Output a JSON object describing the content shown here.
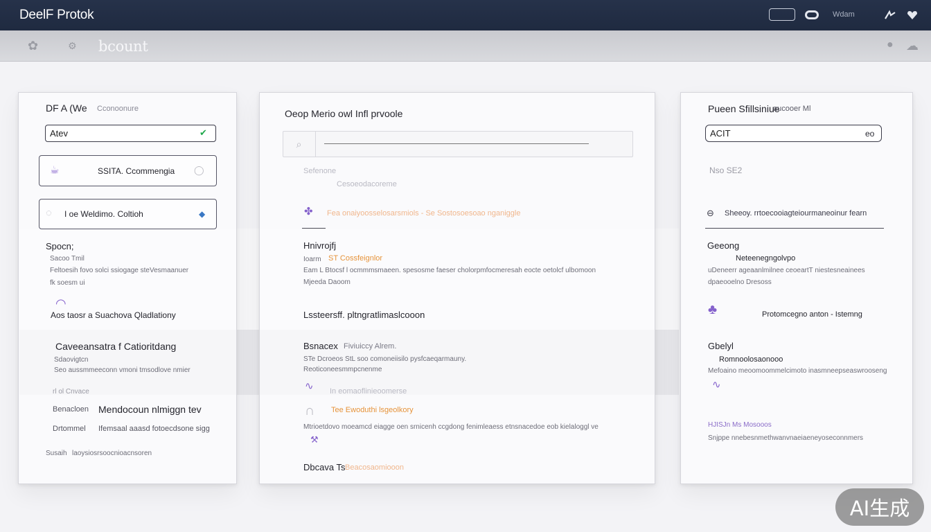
{
  "topbar": {
    "title": "DeelF Protok",
    "status_text": "Wdam",
    "icons": [
      "pill-icon",
      "toggle-icon",
      "share-icon",
      "heart-icon"
    ]
  },
  "subbar": {
    "title": "bcount",
    "icons": [
      "puzzle-icon",
      "gear-icon",
      "user-icon",
      "cloud-icon"
    ]
  },
  "left": {
    "header": "DF A (We",
    "header_sub": "Cconoonure",
    "input_value": "Atev",
    "card1_label": "SSITA. Ccommengia",
    "card2_label": "I oe Weldimo. Coltioh",
    "section1_title": "Spocn;",
    "section1_sub": "Sacoo Tmil",
    "section1_line1": "Feltoesih fovo solci ssiogage steVesmaanuer",
    "section1_line2": "fk soesm ui",
    "section2_title": "Aos taosr a Suachova Qladlationy",
    "section3_title": "Caveeansatra f Catioritdang",
    "section3_line1": "Sdaovigtcn",
    "section3_line2": "Seo aussmmeeconn vmoni tmsodlove nmier",
    "section3_line3": "rl ol Cnvace",
    "row1_key": "Benacloen",
    "row1_value": "Mendocoun nlmiggn tev",
    "row2_key": "Drtommel",
    "row2_value": "Ifemsaal aaasd fotoecdsone sigg",
    "row3_key": "Susaih",
    "row3_value": "laoysiosrsoocnioacnsoren"
  },
  "middle": {
    "header": "Oeop Merio owl Infl prvoole",
    "faint_line": "Sefenone",
    "faint_line2": "Cesoeodacoreme",
    "orange_row": "Fea onaiyoosselosarsmiols - Se Sostosoesoao nganiggle",
    "section1_title": "Hnivrojfj",
    "section1_sub_prefix": "Ioarm",
    "section1_sub": "ST Cossfeignlor",
    "section1_line1": "Eam L Btocsf l ocmmmsmaeen. spesosme faeser cholorpmfocmeresah eocte oetolcf ulbomoon",
    "section1_line2": "Mjeeda Daoom",
    "section2_title": "Lssteersff. pltngratlimaslcooon",
    "section3_title": "Bsnacex",
    "section3_sub": "Fiviuiccy Alrem.",
    "section3_line1": "STe Dcroeos StL soo comoneiisilo pysfcaeqarmauny.",
    "section3_line2": "Reoticoneesmmpcnenme",
    "section4_faint": "In eomaoflinieoomerse",
    "section4_orange": "Tee Ewoduthi lsgeolkory",
    "section4_line": "Mtrioetdovo moeamcd eiagge oen srnicenh ccgdong fenimleaess etnsnacedoe eob kielaloggl ve",
    "section5_title": "Dbcava Ts",
    "section5_sub": "Beacosaomiooon"
  },
  "right": {
    "header": "Pueen Sfillsiniue",
    "header_sub": "aucooer  Ml",
    "input_value": "ACIT",
    "input_suffix": "eo",
    "faint_value": "Nso  SE2",
    "link_row": "Sheeoy. rrtoecooiagteiourmaneoinur fearn",
    "section1_title": "Geeong",
    "section1_sub": "Neteenegngolvpo",
    "section1_line1": "uDeneerr ageaanlmilnee ceoeartT niestesneainees",
    "section1_line2": "dpaeooelno Dresoss",
    "tag_label": "Protomcegno anton - Istemng",
    "section2_title": "Gbelyl",
    "section2_sub": "Romnoolosaonooo",
    "section2_line": "Mefoaino meoomoommelcimoto inasmneepseaswrooseng",
    "section3_faint": "HJISJn  Ms Mosooos",
    "section3_line": "Snjppe nnebesnmethwanvnaeiaeneyoseconnmers"
  },
  "badge_text": "AI生成"
}
